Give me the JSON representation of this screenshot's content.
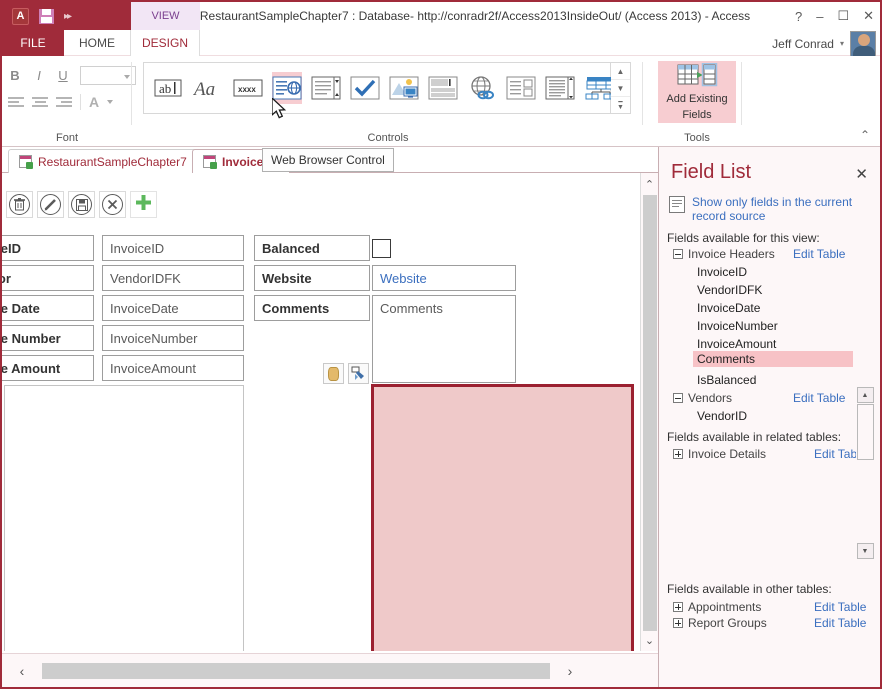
{
  "window": {
    "title": "RestaurantSampleChapter7 : Database- http://conradr2f/Access2013InsideOut/ (Access 2013) - Access",
    "help": "?",
    "minimize": "–",
    "maximize": "☐",
    "close": "✕",
    "qat": {
      "app_icon": "access-icon",
      "save": "save-icon",
      "more": "▸▸"
    },
    "view_tab": "VIEW",
    "user_name": "Jeff Conrad",
    "user_caret": "▾"
  },
  "ribbon_tabs": [
    {
      "label": "FILE",
      "active": false
    },
    {
      "label": "HOME",
      "active": false
    },
    {
      "label": "DESIGN",
      "active": true
    }
  ],
  "ribbon": {
    "collapse_caret": "⌃",
    "groups": [
      {
        "name": "Font",
        "label": "Font"
      },
      {
        "name": "Controls",
        "label": "Controls"
      },
      {
        "name": "Tools",
        "label": "Tools"
      }
    ],
    "font": {
      "bold": "B",
      "italic": "I",
      "underline": "U",
      "font_size_value": "",
      "align_left": "align-left-icon",
      "align_center": "align-center-icon",
      "align_right": "align-right-icon",
      "font_color": "A"
    },
    "controls": {
      "items": [
        {
          "name": "text-box-control",
          "glyph": "ab|",
          "selected": false
        },
        {
          "name": "label-control",
          "glyph": "Aa",
          "selected": false
        },
        {
          "name": "button-control",
          "glyph": "xxxx",
          "selected": false
        },
        {
          "name": "web-browser-control",
          "glyph": "web-browser-icon",
          "selected": true
        },
        {
          "name": "combo-box-control",
          "glyph": "combo-box-icon",
          "selected": false
        },
        {
          "name": "check-box-control",
          "glyph": "✔",
          "selected": false
        },
        {
          "name": "image-control",
          "glyph": "image-icon",
          "selected": false
        },
        {
          "name": "attachment-control",
          "glyph": "attachment-icon",
          "selected": false
        },
        {
          "name": "hyperlink-control",
          "glyph": "hyperlink-icon",
          "selected": false
        },
        {
          "name": "subform-control",
          "glyph": "subform-icon",
          "selected": false
        },
        {
          "name": "list-box-control",
          "glyph": "list-box-icon",
          "selected": false
        },
        {
          "name": "navigation-control",
          "glyph": "navigation-icon",
          "selected": false
        }
      ],
      "scroll_up": "▲",
      "scroll_down": "▼",
      "scroll_more": "▼"
    },
    "tools": {
      "add_existing_fields_line1": "Add Existing",
      "add_existing_fields_line2": "Fields"
    }
  },
  "document_tabs": [
    {
      "label": "RestaurantSampleChapter7",
      "active": false
    },
    {
      "label": "Invoice Bl",
      "active": true
    }
  ],
  "document_tab_close": "✕",
  "tooltip": "Web Browser Control",
  "form": {
    "toolbar": [
      {
        "name": "delete-record-button",
        "glyph": "🗑"
      },
      {
        "name": "edit-record-button",
        "glyph": "✎"
      },
      {
        "name": "save-record-button",
        "glyph": "💾"
      },
      {
        "name": "cancel-button",
        "glyph": "✕"
      },
      {
        "name": "add-record-button",
        "glyph": "＋"
      }
    ],
    "labels": [
      {
        "text": "oiceID"
      },
      {
        "text": "ndor"
      },
      {
        "text": "oice Date"
      },
      {
        "text": "oice Number"
      },
      {
        "text": "oice Amount"
      }
    ],
    "fields": [
      {
        "text": "InvoiceID"
      },
      {
        "text": "VendorIDFK"
      },
      {
        "text": "InvoiceDate"
      },
      {
        "text": "InvoiceNumber"
      },
      {
        "text": "InvoiceAmount"
      }
    ],
    "right_labels": [
      {
        "text": "Balanced"
      },
      {
        "text": "Website"
      },
      {
        "text": "Comments"
      }
    ],
    "website_value": "Website",
    "comments_value": "Comments",
    "checkbox_checked": false,
    "small_tools": [
      {
        "name": "data-source-icon",
        "glyph": "barrel"
      },
      {
        "name": "format-painter-icon",
        "glyph": "brush"
      }
    ]
  },
  "scrollbars": {
    "v_up": "⌃",
    "v_down": "⌄",
    "h_left": "‹",
    "h_right": "›"
  },
  "field_list": {
    "title": "Field List",
    "close": "✕",
    "show_only_line1": "Show only fields in the current",
    "show_only_line2": "record source",
    "available_this_view": "Fields available for this view:",
    "available_related": "Fields available in related tables:",
    "available_other": "Fields available in other tables:",
    "edit_table": "Edit Table",
    "tables_this_view": [
      {
        "name": "Invoice Headers",
        "expanded": true,
        "edit_table": "Edit Table",
        "fields": [
          {
            "name": "InvoiceID",
            "highlighted": false
          },
          {
            "name": "VendorIDFK",
            "highlighted": false
          },
          {
            "name": "InvoiceDate",
            "highlighted": false
          },
          {
            "name": "InvoiceNumber",
            "highlighted": false
          },
          {
            "name": "InvoiceAmount",
            "highlighted": false
          },
          {
            "name": "Comments",
            "highlighted": true
          },
          {
            "name": "IsBalanced",
            "highlighted": false
          }
        ]
      },
      {
        "name": "Vendors",
        "expanded": true,
        "edit_table": "Edit Table",
        "fields": [
          {
            "name": "VendorID",
            "highlighted": false
          }
        ]
      }
    ],
    "tables_related": [
      {
        "name": "Invoice Details",
        "expanded": false,
        "edit_table": "Edit Table"
      }
    ],
    "tables_other": [
      {
        "name": "Appointments",
        "expanded": false,
        "edit_table": "Edit Table"
      },
      {
        "name": "Report Groups",
        "expanded": false,
        "edit_table": "Edit Table"
      }
    ],
    "scroll_up": "▲",
    "scroll_down": "▼"
  },
  "colors": {
    "accent_red": "#a02b3a",
    "highlight_pink": "#f7cdd1",
    "selection_border": "#9b2030",
    "selection_fill": "#efc9c9",
    "link_blue": "#3b6fbf"
  }
}
